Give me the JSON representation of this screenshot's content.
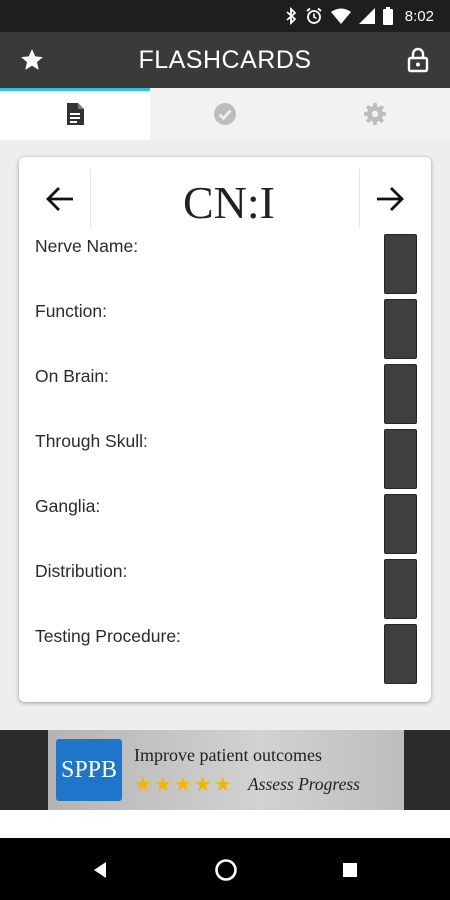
{
  "status_bar": {
    "time": "8:02",
    "icons": [
      "bluetooth-icon",
      "alarm-icon",
      "wifi-icon",
      "signal-icon",
      "battery-icon"
    ]
  },
  "app_bar": {
    "title": "FLASHCARDS",
    "left_icon": "star-icon",
    "right_icon": "lock-icon"
  },
  "tabs": [
    {
      "icon": "document-icon",
      "active": true
    },
    {
      "icon": "check-circle-icon",
      "active": false
    },
    {
      "icon": "gear-icon",
      "active": false
    }
  ],
  "card": {
    "title": "CN:I",
    "prev_icon": "arrow-left-icon",
    "next_icon": "arrow-right-icon",
    "fields": [
      {
        "label": "Nerve Name:"
      },
      {
        "label": "Function:"
      },
      {
        "label": "On Brain:"
      },
      {
        "label": "Through Skull:"
      },
      {
        "label": "Ganglia:"
      },
      {
        "label": "Distribution:"
      },
      {
        "label": "Testing Procedure:"
      }
    ]
  },
  "ad": {
    "logo_text": "SPPB",
    "headline": "Improve patient outcomes",
    "stars": "★★★★★",
    "cta": "Assess Progress"
  },
  "nav_bar": {
    "buttons": [
      "back-icon",
      "home-icon",
      "recents-icon"
    ]
  },
  "colors": {
    "app_bar": "#3a3a3a",
    "tab_indicator": "#2ec4d6",
    "reveal_button": "#3f3f3f",
    "star": "#f6b400",
    "ad_logo": "#1f75c9"
  }
}
